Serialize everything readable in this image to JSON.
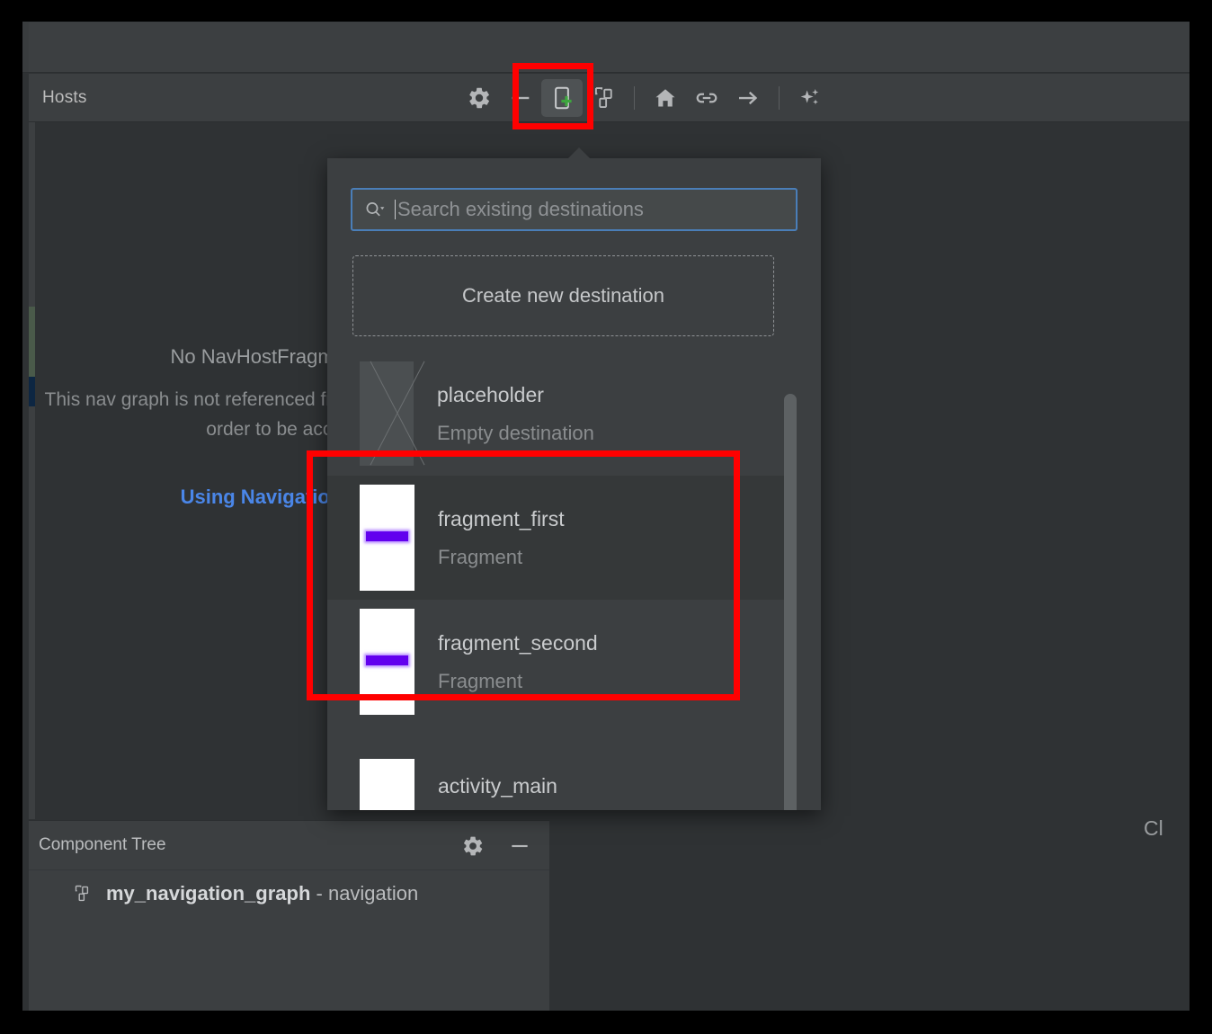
{
  "window": {
    "hosts_panel_title": "Hosts"
  },
  "toolbar": {
    "items": [
      {
        "name": "settings-icon",
        "label": "Settings"
      },
      {
        "name": "zoom-out-icon",
        "label": "Zoom out"
      },
      {
        "name": "new-destination-icon",
        "label": "New Destination"
      },
      {
        "name": "nested-graph-icon",
        "label": "Nested Graph"
      },
      {
        "name": "set-start-destination-icon",
        "label": "Set Start Destination"
      },
      {
        "name": "new-action-icon",
        "label": "New Action"
      },
      {
        "name": "arrow-right-icon",
        "label": "Action"
      },
      {
        "name": "ai-sparkle-icon",
        "label": "AI Assistant"
      }
    ]
  },
  "canvas": {
    "empty_title": "No NavHostFragments found",
    "empty_body": "This nav graph is not referenced from a NavHostFragment in order to be accessible",
    "empty_link": "Using Navigation Graphs"
  },
  "popup": {
    "search": {
      "placeholder": "Search existing destinations",
      "value": ""
    },
    "create_new_label": "Create new destination",
    "destinations": [
      {
        "name": "placeholder",
        "type": "Empty destination",
        "thumb": "placeholder",
        "hovered": false
      },
      {
        "name": "fragment_first",
        "type": "Fragment",
        "thumb": "fragment",
        "hovered": true
      },
      {
        "name": "fragment_second",
        "type": "Fragment",
        "thumb": "fragment",
        "hovered": false
      },
      {
        "name": "activity_main",
        "type": "",
        "thumb": "activity",
        "hovered": false
      }
    ]
  },
  "component_tree": {
    "title": "Component Tree",
    "actions": [
      {
        "name": "settings-icon",
        "label": "Settings"
      },
      {
        "name": "minimize-icon",
        "label": "Minimize"
      }
    ],
    "rows": [
      {
        "name": "my_navigation_graph",
        "separator": " - ",
        "type": "navigation"
      }
    ]
  },
  "right_edge": {
    "clipped_text": "Cl"
  },
  "colors": {
    "accent_blue": "#4a86e8",
    "focus_border": "#4a7eb8",
    "annotation_red": "#ff0000",
    "add_green": "#3ea63e",
    "fragment_button_purple": "#6200ee",
    "panel_bg": "#3c3f41",
    "canvas_bg": "#2f3234"
  }
}
